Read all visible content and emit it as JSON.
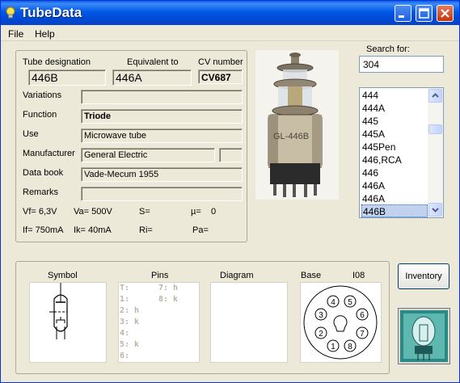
{
  "window": {
    "title": "TubeData"
  },
  "menu": {
    "file": "File",
    "help": "Help"
  },
  "details": {
    "designation_label": "Tube designation",
    "equivalent_label": "Equivalent to",
    "cv_label": "CV number",
    "designation": "446B",
    "equivalent": "446A",
    "cv": "CV687",
    "variations_label": "Variations",
    "variations": "",
    "function_label": "Function",
    "function": "Triode",
    "use_label": "Use",
    "use": "Microwave tube",
    "manufacturer_label": "Manufacturer",
    "manufacturer": "General Electric",
    "manufacturer_extra": "",
    "databook_label": "Data book",
    "databook": "Vade-Mecum 1955",
    "remarks_label": "Remarks",
    "remarks": ""
  },
  "params": {
    "vf": "Vf= 6,3V",
    "va": "Va= 500V",
    "s": "S=",
    "mu": "µ=",
    "mu_value": "0",
    "if": "If= 750mA",
    "ik": "Ik= 40mA",
    "ri": "Ri=",
    "pa": "Pa="
  },
  "photo": {
    "tube_label": "GL-446B"
  },
  "search": {
    "label": "Search for:",
    "value": "304"
  },
  "list": {
    "items": [
      "444",
      "444A",
      "445",
      "445A",
      "445Pen",
      "446,RCA",
      "446",
      "446A",
      "446A",
      "446B"
    ],
    "selected_index": 9
  },
  "bottom": {
    "symbol_label": "Symbol",
    "pins_label": "Pins",
    "diagram_label": "Diagram",
    "base_label": "Base",
    "base_type": "I08",
    "pins_col1": [
      "T:",
      "1:",
      "2: h",
      "3: k",
      "4:",
      "5: k",
      "6:"
    ],
    "pins_col2": [
      "7: h",
      "8: k"
    ],
    "base_pins": [
      "1",
      "2",
      "3",
      "4",
      "5",
      "6",
      "7",
      "8"
    ]
  },
  "inventory_button": "Inventory",
  "colors": {
    "titlebar": "#0058e6",
    "selection": "#c1d2ee",
    "window_bg": "#ece9d8"
  }
}
